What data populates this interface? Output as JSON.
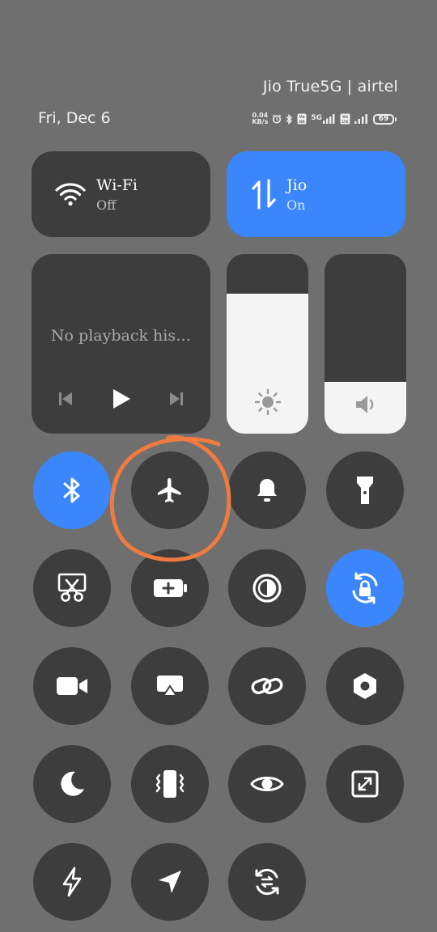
{
  "status_bar": {
    "carrier": "Jio True5G | airtel",
    "date": "Fri, Dec 6",
    "net_speed_value": "0.04",
    "net_speed_unit": "KB/s",
    "network_5g": "5G",
    "battery_level": "69"
  },
  "tiles": {
    "wifi": {
      "label": "Wi-Fi",
      "state": "Off",
      "active": false
    },
    "mobile_data": {
      "label": "Jio",
      "state": "On",
      "active": true
    }
  },
  "media": {
    "message": "No playback his…"
  },
  "sliders": {
    "brightness": {
      "level": 0.78
    },
    "volume": {
      "level": 0.29
    }
  },
  "toggles": [
    {
      "name": "bluetooth",
      "icon": "bluetooth-icon",
      "active": true
    },
    {
      "name": "airplane-mode",
      "icon": "airplane-icon",
      "active": false
    },
    {
      "name": "sound",
      "icon": "bell-icon",
      "active": false
    },
    {
      "name": "flashlight",
      "icon": "flashlight-icon",
      "active": false
    },
    {
      "name": "screenshot",
      "icon": "scissors-icon",
      "active": false
    },
    {
      "name": "battery-saver",
      "icon": "battery-plus-icon",
      "active": false
    },
    {
      "name": "reading-mode",
      "icon": "contrast-icon",
      "active": false
    },
    {
      "name": "rotation-lock",
      "icon": "rotation-lock-icon",
      "active": true
    },
    {
      "name": "screen-recorder",
      "icon": "video-camera-icon",
      "active": false
    },
    {
      "name": "cast",
      "icon": "cast-icon",
      "active": false
    },
    {
      "name": "link-sharing",
      "icon": "link-icon",
      "active": false
    },
    {
      "name": "settings",
      "icon": "hexagon-icon",
      "active": false
    },
    {
      "name": "dark-mode",
      "icon": "moon-icon",
      "active": false
    },
    {
      "name": "vibrate",
      "icon": "vibrate-icon",
      "active": false
    },
    {
      "name": "eye-comfort",
      "icon": "eye-icon",
      "active": false
    },
    {
      "name": "floating-window",
      "icon": "resize-icon",
      "active": false
    },
    {
      "name": "ultra-battery-saver",
      "icon": "lightning-icon",
      "active": false
    },
    {
      "name": "location",
      "icon": "location-arrow-icon",
      "active": false
    },
    {
      "name": "sync",
      "icon": "sync-icon",
      "active": false
    }
  ],
  "annotation": {
    "color": "#f07a3f",
    "target": "airplane-mode"
  },
  "colors": {
    "accent": "#3b86fb",
    "tile": "#3d3d3d",
    "background": "#6f6f6f"
  }
}
